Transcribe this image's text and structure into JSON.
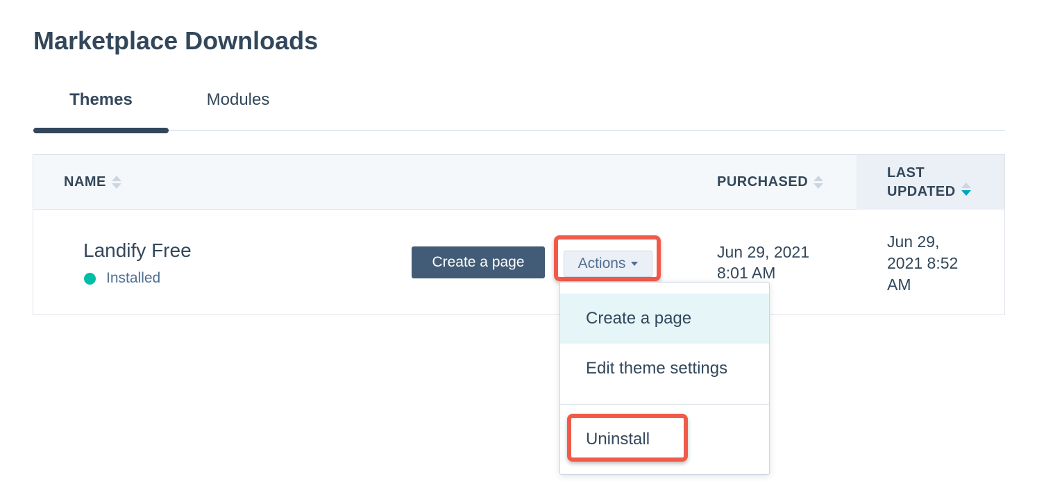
{
  "page": {
    "title": "Marketplace Downloads"
  },
  "tabs": [
    {
      "label": "Themes",
      "active": true
    },
    {
      "label": "Modules",
      "active": false
    }
  ],
  "table": {
    "columns": [
      {
        "label": "NAME",
        "sort": "none"
      },
      {
        "label": "PURCHASED",
        "sort": "none"
      },
      {
        "label_line1": "LAST",
        "label_line2": "UPDATED",
        "sort": "descending"
      }
    ],
    "rows": [
      {
        "name": "Landify Free",
        "status": "Installed",
        "create_button": "Create a page",
        "actions_button": "Actions",
        "purchased": [
          "Jun 29, 2021",
          "8:01 AM"
        ],
        "last_updated": [
          "Jun 29,",
          "2021 8:52",
          "AM"
        ]
      }
    ]
  },
  "dropdown": {
    "items": [
      "Create a page",
      "Edit theme settings",
      "Uninstall"
    ]
  },
  "colors": {
    "primary_text": "#33475b",
    "status_installed": "#00bda5",
    "highlight": "#f15a49",
    "sort_active": "#00a4bd"
  }
}
